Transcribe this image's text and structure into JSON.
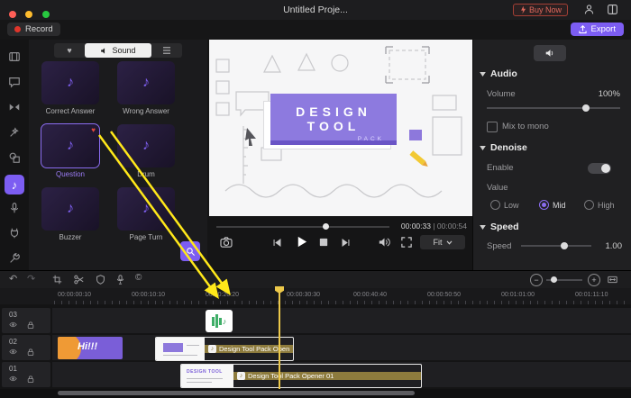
{
  "titlebar": {
    "title": "Untitled Proje...",
    "buy_now": "Buy Now"
  },
  "toolbar": {
    "record": "Record",
    "export": "Export"
  },
  "sound_panel": {
    "sound_tab": "Sound",
    "items": [
      {
        "label": "Correct Answer"
      },
      {
        "label": "Wrong Answer"
      },
      {
        "label": "Question"
      },
      {
        "label": "Drum"
      },
      {
        "label": "Buzzer"
      },
      {
        "label": "Page Turn"
      }
    ]
  },
  "preview": {
    "card_title": "DESIGN TOOL",
    "card_subtitle": "PACK",
    "time_current": "00:00:33",
    "time_sep": " | ",
    "time_total": "00:00:54",
    "fit_label": "Fit"
  },
  "properties": {
    "audio_header": "Audio",
    "volume_label": "Volume",
    "volume_value": "100%",
    "mix_to_mono": "Mix to mono",
    "denoise_header": "Denoise",
    "enable_label": "Enable",
    "value_label": "Value",
    "options": [
      {
        "label": "Low"
      },
      {
        "label": "Mid"
      },
      {
        "label": "High"
      }
    ],
    "selected_option": "Mid",
    "speed_header": "Speed",
    "speed_label": "Speed",
    "speed_value": "1.00"
  },
  "timeline": {
    "ruler": [
      {
        "t": "00:00:00:10"
      },
      {
        "t": "00:00:10:10"
      },
      {
        "t": "00:00:20:20"
      },
      {
        "t": "00:00:30:30"
      },
      {
        "t": "00:00:40:40"
      },
      {
        "t": "00:00:50:50"
      },
      {
        "t": "00:01:01:00"
      },
      {
        "t": "00:01:11:10"
      }
    ],
    "tracks": [
      {
        "num": "03"
      },
      {
        "num": "02"
      },
      {
        "num": "01"
      }
    ],
    "clips": {
      "hi": "Hi!!!",
      "open": "Design Tool Pack Open",
      "opener": "Design Tool Pack Opener 01",
      "thumb_title": "DESIGN TOOL"
    }
  },
  "icons": {
    "heart": "♥",
    "note": "♪",
    "copyright": "©",
    "undo": "↶",
    "redo": "↷",
    "minus": "−",
    "plus": "+"
  },
  "colors": {
    "accent": "#7c5df2",
    "buy_now": "#e0685c",
    "clip_yellow": "#8d7b3d",
    "audio_clip_green": "#3fae68",
    "playhead": "#ecc84a",
    "annotation_arrow": "#ffe81a"
  }
}
